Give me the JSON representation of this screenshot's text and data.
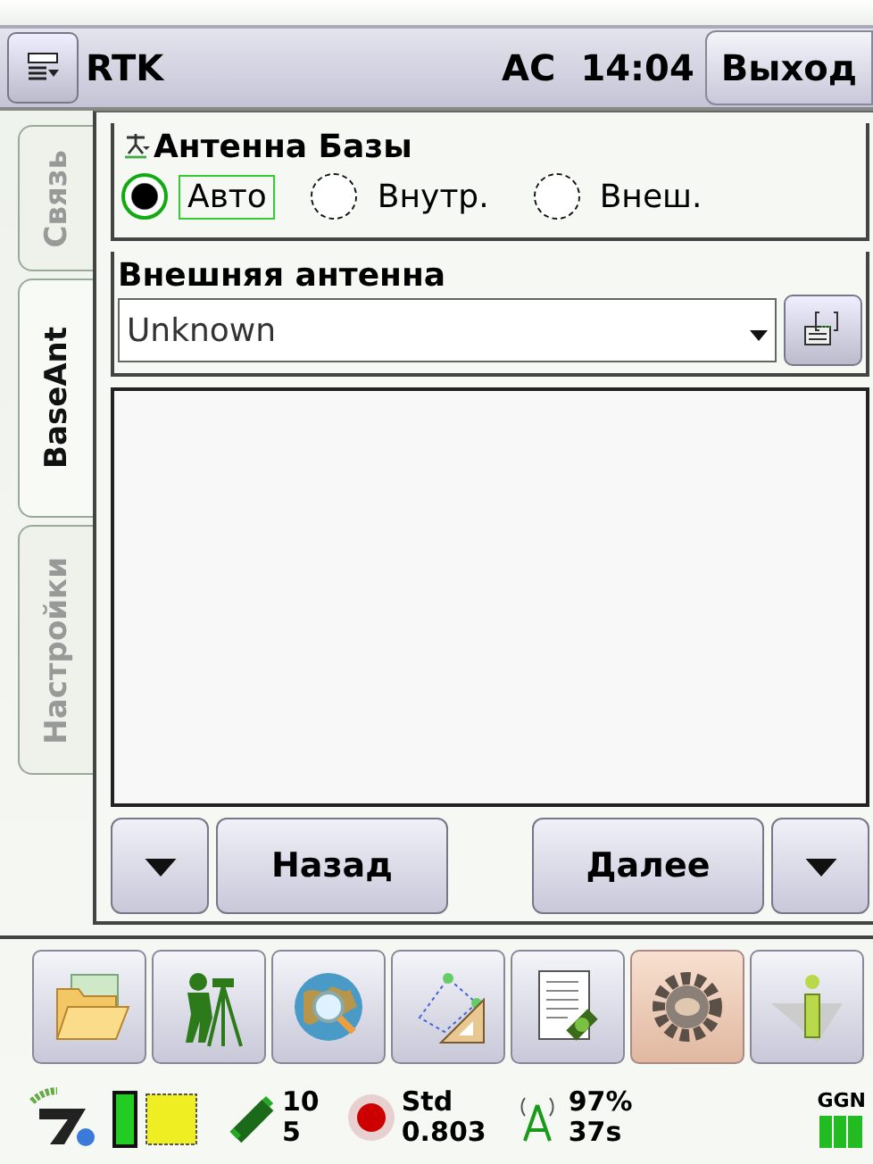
{
  "title_bar": {
    "title": "RTK",
    "indicator": "AC",
    "time": "14:04",
    "exit_button": "Выход"
  },
  "side_tabs": [
    {
      "label": "Связь",
      "selected": false
    },
    {
      "label": "BaseAnt",
      "selected": true
    },
    {
      "label": "Настройки",
      "selected": false
    }
  ],
  "base_antenna": {
    "legend": "Антенна Базы",
    "options": [
      {
        "label": "Авто",
        "selected": true
      },
      {
        "label": "Внутр.",
        "selected": false
      },
      {
        "label": "Внеш.",
        "selected": false
      }
    ]
  },
  "external_antenna": {
    "legend": "Внешняя антенна",
    "value": "Unknown"
  },
  "nav_buttons": [
    {
      "kind": "menu"
    },
    {
      "kind": "text",
      "label": "Назад"
    },
    {
      "kind": "spacer"
    },
    {
      "kind": "text",
      "label": "Далее"
    },
    {
      "kind": "menu"
    }
  ],
  "toolbar": [
    {
      "kind": "folder",
      "selected": false
    },
    {
      "kind": "surveyor",
      "selected": false
    },
    {
      "kind": "globe",
      "selected": false
    },
    {
      "kind": "cogo",
      "selected": false
    },
    {
      "kind": "notebook",
      "selected": false
    },
    {
      "kind": "gear",
      "selected": true
    },
    {
      "kind": "info",
      "selected": false
    }
  ],
  "status_bar": {
    "satellites": [
      "10",
      "5"
    ],
    "solution": [
      "Std",
      "0.803"
    ],
    "radio": [
      "97%",
      "37s"
    ],
    "nmea": "GGN"
  }
}
